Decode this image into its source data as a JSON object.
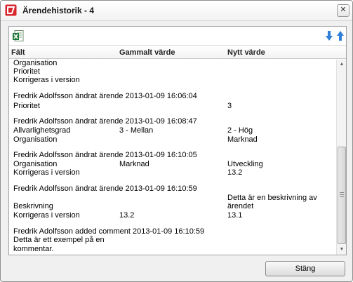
{
  "window": {
    "title": "Ärendehistorik - 4",
    "app_icon": "app-logo-icon",
    "close_symbol": "✕"
  },
  "toolbar": {
    "export_icon": "excel-export-icon",
    "sort_down_icon": "arrow-down-icon",
    "sort_up_icon": "arrow-up-icon"
  },
  "columns": {
    "field": "Fält",
    "old_value": "Gammalt värde",
    "new_value": "Nytt värde"
  },
  "entries": [
    {
      "field": "Organisation",
      "old": "",
      "new": ""
    },
    {
      "field": "Prioritet",
      "old": "",
      "new": ""
    },
    {
      "field": "Korrigeras i version",
      "old": "",
      "new": ""
    },
    {
      "header": "Fredrik Adolfsson ändrat ärende 2013-01-09 16:06:04"
    },
    {
      "field": "Prioritet",
      "old": "",
      "new": "3"
    },
    {
      "header": "Fredrik Adolfsson ändrat ärende 2013-01-09 16:08:47"
    },
    {
      "field": "Allvarlighetsgrad",
      "old": "3 - Mellan",
      "new": "2 - Hög"
    },
    {
      "field": "Organisation",
      "old": "",
      "new": "Marknad"
    },
    {
      "header": "Fredrik Adolfsson ändrat ärende 2013-01-09 16:10:05"
    },
    {
      "field": "Organisation",
      "old": "Marknad",
      "new": "Utveckling"
    },
    {
      "field": "Korrigeras i version",
      "old": "",
      "new": "13.2"
    },
    {
      "header": "Fredrik Adolfsson ändrat ärende 2013-01-09 16:10:59"
    },
    {
      "field": "Beskrivning",
      "old": "",
      "new": "Detta är en beskrivning av ärendet"
    },
    {
      "field": "Korrigeras i version",
      "old": "13.2",
      "new": "13.1"
    },
    {
      "header": "Fredrik Adolfsson added comment 2013-01-09 16:10:59"
    },
    {
      "comment_line_1": "Detta är ett exempel på en",
      "comment_line_2": "kommentar."
    }
  ],
  "footer": {
    "close_label": "Stäng"
  },
  "colors": {
    "accent_red": "#d8262c",
    "excel_green": "#1f7a3a",
    "arrow_blue": "#2f7fd9"
  }
}
